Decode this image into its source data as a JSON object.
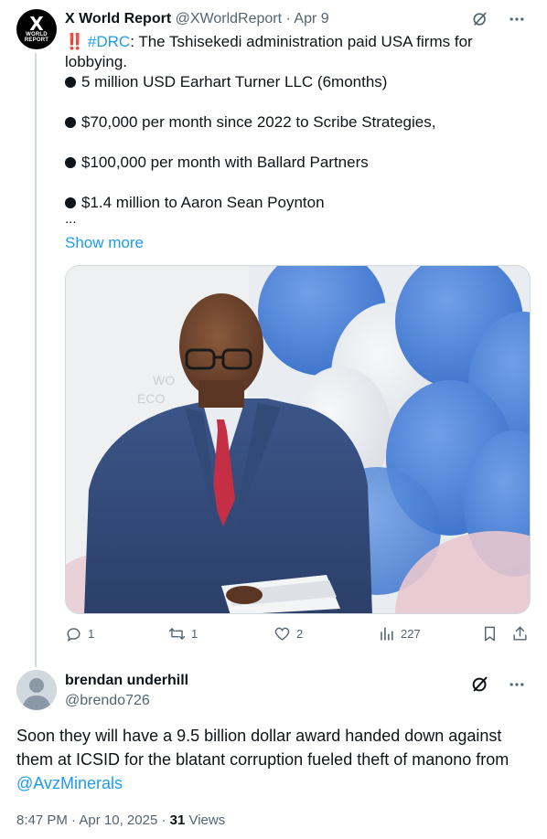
{
  "tweet": {
    "avatar_text": "X",
    "avatar_subtext": "WORLD REPORT",
    "author_name": "X World Report",
    "author_handle": "@XWorldReport",
    "separator": "·",
    "date": "Apr 9",
    "alert_emoji": "‼️",
    "hashtag": "#DRC",
    "intro_text": ": The Tshisekedi administration paid USA firms for lobbying.",
    "bullets": [
      "5 million USD Earhart Turner LLC (6months)",
      "$70,000 per month since 2022 to Scribe Strategies,",
      "$100,000 per month with Ballard Partners",
      "$1.4 million to Aaron Sean Poynton"
    ],
    "truncation": "...",
    "show_more": "Show more",
    "stats": {
      "replies": "1",
      "reposts": "1",
      "likes": "2",
      "views": "227"
    }
  },
  "reply": {
    "author_name": "brendan underhill",
    "author_handle": "@brendo726",
    "text_before_mention": "Soon they will have a 9.5 billion dollar award handed down against them at ICSID for the blatant corruption fueled theft of manono from ",
    "mention": "@AvzMinerals",
    "time": "8:47 PM",
    "separator1": " · ",
    "date": "Apr 10, 2025",
    "separator2": " · ",
    "views_count": "31",
    "views_label": " Views"
  },
  "colors": {
    "link": "#1d9bf0",
    "muted": "#536471",
    "text": "#0f1419",
    "alert": "#e0245e"
  },
  "icons": [
    "grok-icon",
    "more-icon",
    "reply-icon",
    "repost-icon",
    "like-icon",
    "views-icon",
    "bookmark-icon",
    "share-icon"
  ]
}
